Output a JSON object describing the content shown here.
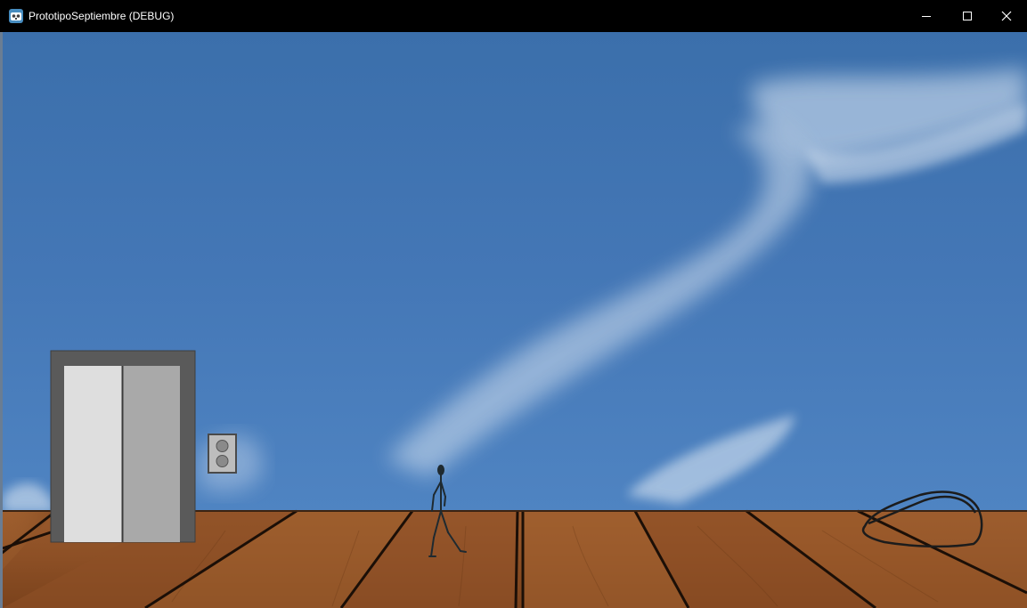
{
  "window": {
    "title": "PrototipoSeptiembre (DEBUG)",
    "app_icon": "godot-engine-icon",
    "controls": {
      "minimize": "minimize-icon",
      "maximize": "maximize-icon",
      "close": "close-icon"
    }
  },
  "scene": {
    "background": "sky-with-clouds",
    "floor": "wooden-planks",
    "objects": [
      "elevator",
      "elevator-call-panel",
      "stick-figure-player",
      "rock-outline"
    ]
  },
  "colors": {
    "titlebar": "#000000",
    "sky": "#4376b5",
    "elevator_frame": "#5a5a5a",
    "elevator_door_left": "#dedede",
    "elevator_door_right": "#a9a9a9",
    "wood": "#8a4f24"
  }
}
